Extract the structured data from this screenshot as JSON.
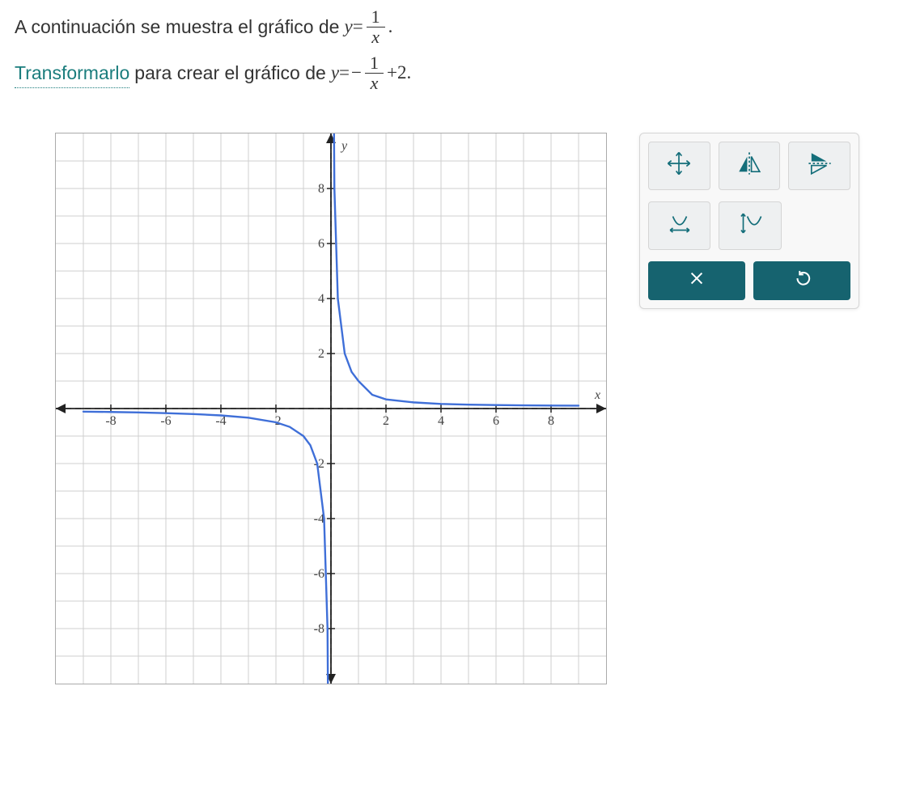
{
  "problem": {
    "line1_prefix": "A continuación se muestra el gráfico de ",
    "eq1_lhs": "y",
    "eq1_equals": "=",
    "eq1_frac_num": "1",
    "eq1_frac_den": "x",
    "eq1_suffix": ".",
    "line2_link": "Transformarlo",
    "line2_mid": " para crear el gráfico de ",
    "eq2_lhs": "y",
    "eq2_equals": "=",
    "eq2_minus": "−",
    "eq2_frac_num": "1",
    "eq2_frac_den": "x",
    "eq2_plus": "+2",
    "eq2_suffix": "."
  },
  "chart_data": {
    "type": "line",
    "title": "",
    "xlabel": "x",
    "ylabel": "y",
    "xlim": [
      -9,
      9
    ],
    "ylim": [
      -9,
      9
    ],
    "x_ticks": [
      -8,
      -6,
      -4,
      -2,
      2,
      4,
      6,
      8
    ],
    "y_ticks": [
      -8,
      -6,
      -4,
      -2,
      2,
      4,
      6,
      8
    ],
    "grid": true,
    "function": "y = 1/x",
    "asymptotes": {
      "vertical": 0,
      "horizontal": 0
    },
    "x": [
      -9,
      -8,
      -6,
      -4,
      -2,
      -1,
      -0.5,
      -0.25,
      -0.125,
      0.125,
      0.25,
      0.5,
      1,
      2,
      4,
      6,
      8,
      9
    ],
    "values": [
      -0.111,
      -0.125,
      -0.167,
      -0.25,
      -0.5,
      -1,
      -2,
      -4,
      -8,
      8,
      4,
      2,
      1,
      0.5,
      0.25,
      0.167,
      0.125,
      0.111
    ]
  },
  "toolbox": {
    "tool_translate": "translate",
    "tool_reflect_v": "reflect-vertical",
    "tool_reflect_h": "reflect-horizontal",
    "tool_stretch_h": "stretch-horizontal",
    "tool_stretch_v": "stretch-vertical",
    "action_delete": "delete",
    "action_undo": "undo"
  },
  "axis_labels": {
    "x": "x",
    "y": "y",
    "xn8": "-8",
    "xn6": "-6",
    "xn4": "-4",
    "xn2": "-2",
    "xp2": "2",
    "xp4": "4",
    "xp6": "6",
    "xp8": "8",
    "yn8": "-8",
    "yn6": "-6",
    "yn4": "-4",
    "yn2": "-2",
    "yp2": "2",
    "yp4": "4",
    "yp6": "6",
    "yp8": "8"
  }
}
